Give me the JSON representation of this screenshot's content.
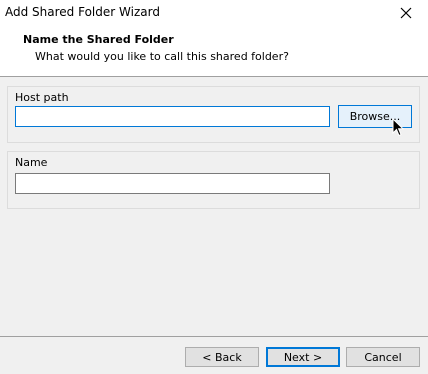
{
  "window": {
    "title": "Add Shared Folder Wizard",
    "close_icon": "close-icon"
  },
  "header": {
    "title": "Name the Shared Folder",
    "subtitle": "What would you like to call this shared folder?"
  },
  "host_path": {
    "label": "Host path",
    "value": "",
    "browse_label": "Browse..."
  },
  "name": {
    "label": "Name",
    "value": ""
  },
  "footer": {
    "back_label": "< Back",
    "next_label": "Next >",
    "cancel_label": "Cancel"
  },
  "colors": {
    "accent": "#0078d7",
    "background": "#f0f0f0"
  }
}
